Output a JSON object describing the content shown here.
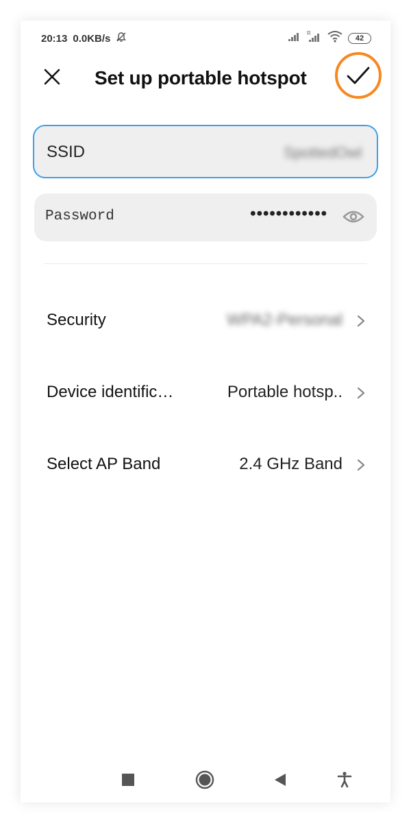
{
  "status_bar": {
    "time": "20:13",
    "speed": "0.0KB/s",
    "battery": "42"
  },
  "header": {
    "title": "Set up portable hotspot",
    "close_icon": "close-icon",
    "confirm_icon": "checkmark-icon"
  },
  "ssid": {
    "label": "SSID",
    "value": "SpottedOwl"
  },
  "password": {
    "label": "Password",
    "value": "••••••••••••"
  },
  "settings": [
    {
      "label": "Security",
      "value": "WPA2-Personal"
    },
    {
      "label": "Device identific…",
      "value": "Portable hotsp.."
    },
    {
      "label": "Select AP Band",
      "value": "2.4 GHz Band"
    }
  ],
  "colors": {
    "accent_blue": "#3aa0e8",
    "highlight_orange": "#f7881f"
  }
}
